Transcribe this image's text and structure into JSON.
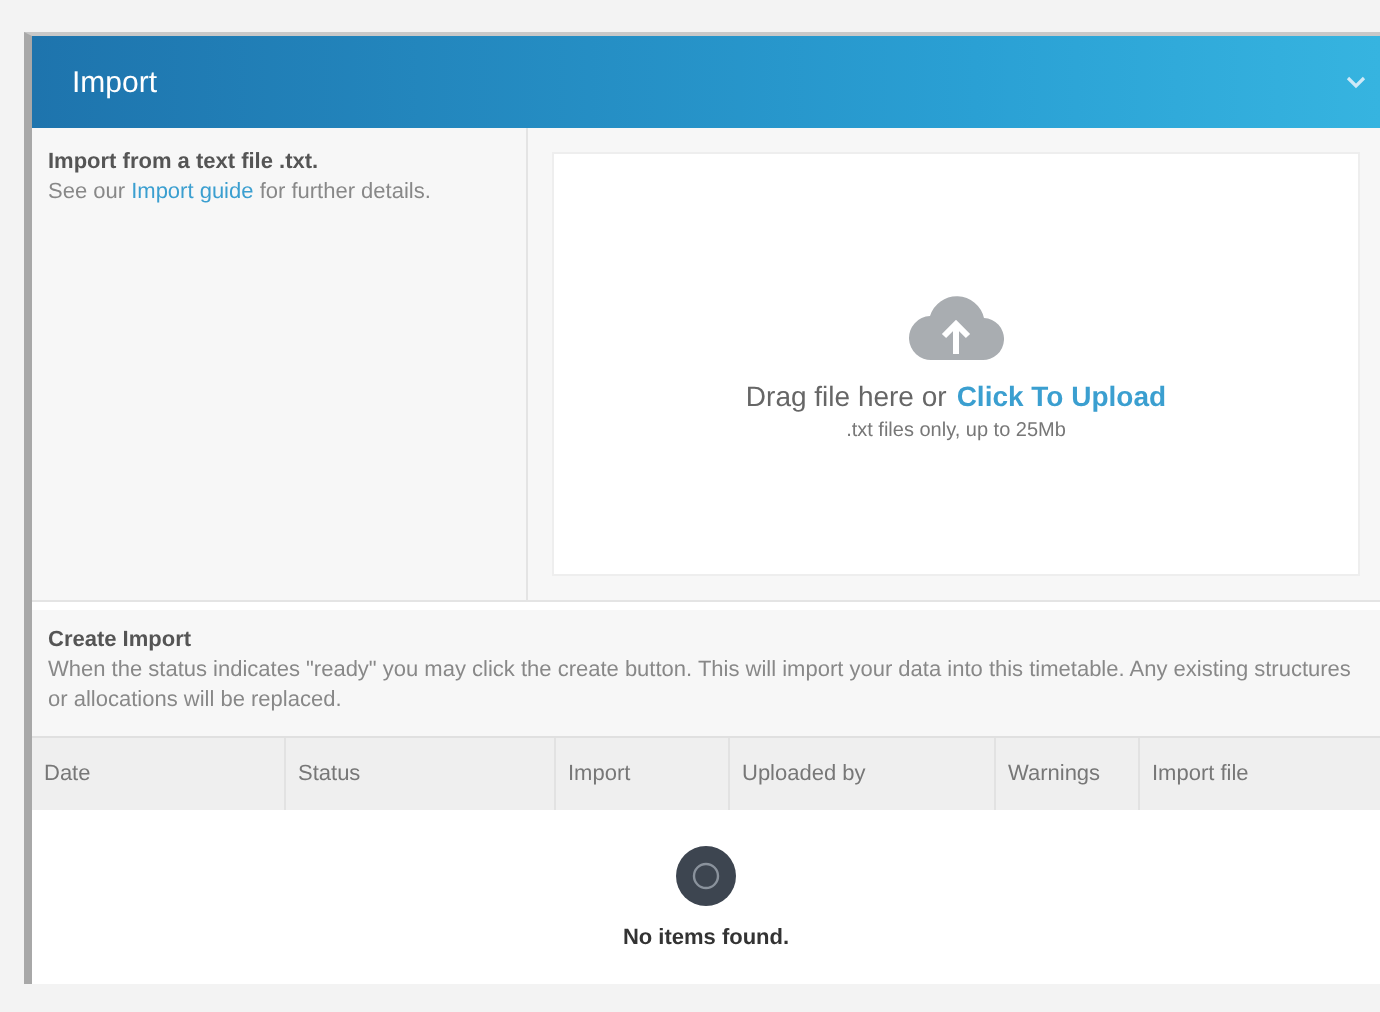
{
  "panel": {
    "title": "Import",
    "expanded": true
  },
  "intro": {
    "heading": "Import from a text file .txt.",
    "text_before": "See our",
    "link": "Import guide",
    "text_after": "for further details."
  },
  "upload": {
    "prompt": "Drag file here or",
    "link": "Click To Upload",
    "hint": ".txt files only, up to 25Mb"
  },
  "create_import": {
    "heading": "Create Import",
    "description": "When the status indicates \"ready\" you may click the create button. This will import your data into this timetable. Any existing structures or allocations will be replaced."
  },
  "table": {
    "columns": [
      "Date",
      "Status",
      "Import",
      "Uploaded by",
      "Warnings",
      "Import file"
    ],
    "empty_message": "No items found."
  }
}
